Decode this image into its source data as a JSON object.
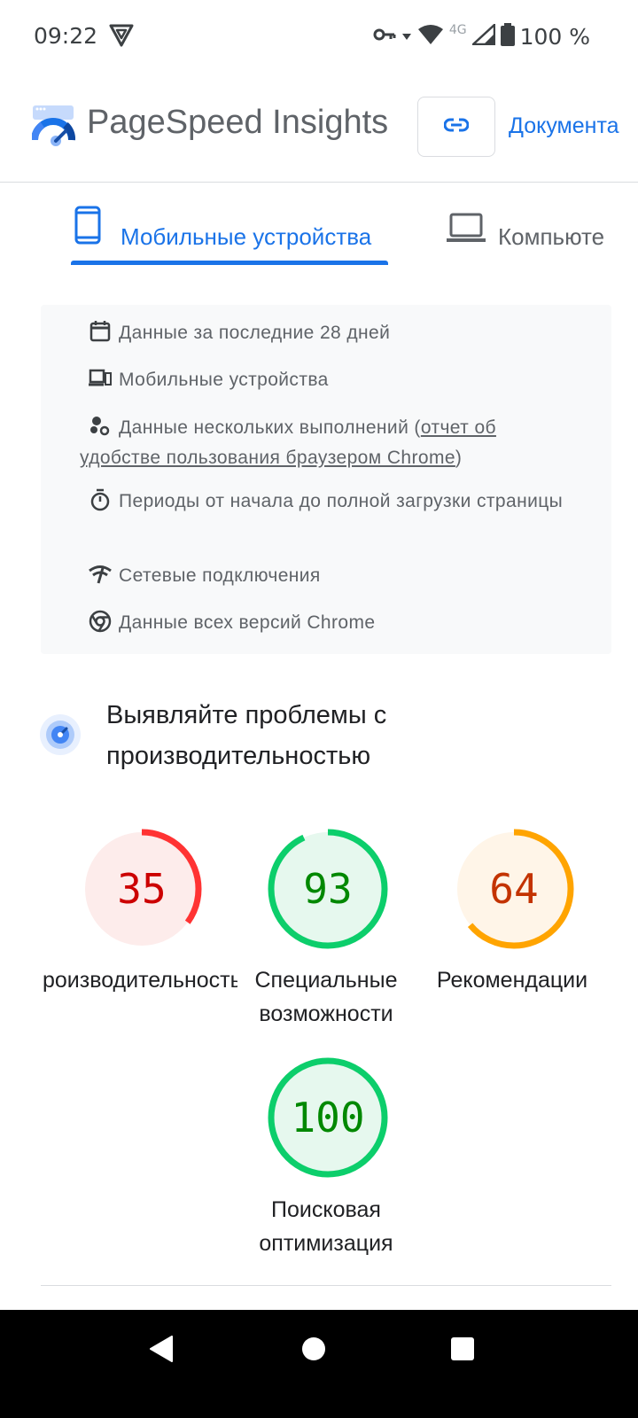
{
  "status_bar": {
    "time": "09:22",
    "network": "4G",
    "battery": "100 %"
  },
  "header": {
    "title": "PageSpeed Insights",
    "docs_link": "Документа"
  },
  "tabs": [
    {
      "label": "Мобильные устройства",
      "active": true
    },
    {
      "label": "Компьюте",
      "active": false
    }
  ],
  "info": {
    "period": "Данные за последние 28 дней",
    "devices": "Мобильные устройства",
    "samples_prefix": "Данные нескольких выполнений (",
    "samples_link": "отчет об удобстве пользования браузером Chrome",
    "samples_suffix": ")",
    "durations": "Периоды от начала до полной загрузки страницы",
    "connections": "Сетевые подключения",
    "versions": "Данные всех версий Chrome"
  },
  "section": {
    "title": "Выявляйте проблемы с производительностью"
  },
  "scores": [
    {
      "label": "Производительность",
      "value": "35",
      "color": "#ff3333",
      "text_color": "#cc0000",
      "fill": "#fdeceb"
    },
    {
      "label": "Специальные возможности",
      "value": "93",
      "color": "#0cce6b",
      "text_color": "#008800",
      "fill": "#e6f8ee"
    },
    {
      "label": "Рекомендации",
      "value": "64",
      "color": "#ffa400",
      "text_color": "#c33300",
      "fill": "#fff5e8"
    },
    {
      "label": "Поисковая оптимизация",
      "value": "100",
      "color": "#0cce6b",
      "text_color": "#008800",
      "fill": "#e6f8ee"
    }
  ],
  "icons": {
    "status_vpn": "shield-icon",
    "status_key": "key-icon",
    "status_wifi": "wifi-icon",
    "status_signal": "signal-icon",
    "status_battery": "battery-icon",
    "logo": "pagespeed-logo",
    "link": "link-icon",
    "mobile_tab": "smartphone-icon",
    "desktop_tab": "laptop-icon",
    "calendar": "calendar-icon",
    "devices": "devices-icon",
    "samples": "bubbles-icon",
    "timer": "timer-icon",
    "network": "network-icon",
    "chrome": "chrome-icon",
    "section": "lighthouse-icon"
  }
}
